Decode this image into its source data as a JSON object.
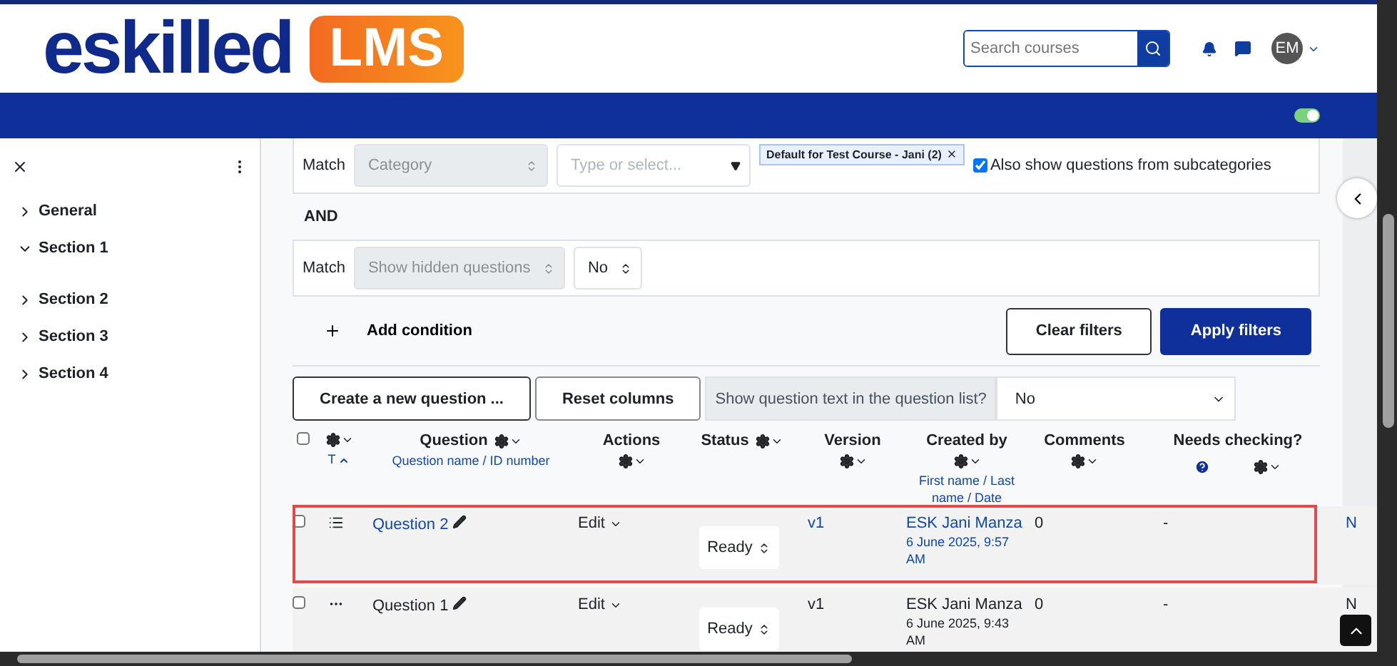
{
  "header": {
    "logo_word": "eskilled",
    "logo_badge": "LMS",
    "search": {
      "placeholder": "Search courses"
    },
    "avatar": "EM"
  },
  "nav": {
    "toggle": {
      "on": true
    }
  },
  "sidebar": {
    "items": [
      {
        "label": "General",
        "expanded": false
      },
      {
        "label": "Section 1",
        "expanded": true
      },
      {
        "label": "Section 2",
        "expanded": false
      },
      {
        "label": "Section 3",
        "expanded": false
      },
      {
        "label": "Section 4",
        "expanded": false
      }
    ]
  },
  "filters": {
    "category": {
      "label": "Match",
      "field": "Category",
      "input_placeholder": "Type or select...",
      "tag": "Default for Test Course - Jani (2)",
      "checkbox": {
        "label": "Also show questions from subcategories",
        "checked": true
      }
    },
    "join": "AND",
    "hidden": {
      "label": "Match",
      "field": "Show hidden questions",
      "value": "No"
    },
    "add_condition": "Add condition",
    "clear": "Clear filters",
    "apply": "Apply filters"
  },
  "toolbar": {
    "create": "Create a new question ...",
    "reset": "Reset columns",
    "show_text_label": "Show question text in the question list?",
    "show_text_value": "No"
  },
  "table": {
    "select_all_checked": false,
    "sort_label": "T",
    "columns": [
      {
        "title": "Question",
        "sub": "Question name / ID number"
      },
      {
        "title": "Actions"
      },
      {
        "title": "Status"
      },
      {
        "title": "Version"
      },
      {
        "title": "Created by",
        "sub": "First name / Last name / Date"
      },
      {
        "title": "Comments"
      },
      {
        "title": "Needs checking?"
      }
    ],
    "rows": [
      {
        "selected": true,
        "checked": false,
        "kind": "list",
        "name": "Question 2",
        "action": "Edit",
        "status": "Ready",
        "version": "v1",
        "creator": "ESK Jani Manza",
        "date": "6 June 2025, 9:57 AM",
        "comments": "0",
        "needs_checking": "-",
        "column_9": "N"
      },
      {
        "selected": false,
        "checked": false,
        "kind": "dots",
        "name": "Question 1",
        "action": "Edit",
        "status": "Ready",
        "version": "v1",
        "creator": "ESK Jani Manza",
        "date": "6 June 2025, 9:43 AM",
        "comments": "0",
        "needs_checking": "-",
        "column_9": "N"
      }
    ]
  }
}
